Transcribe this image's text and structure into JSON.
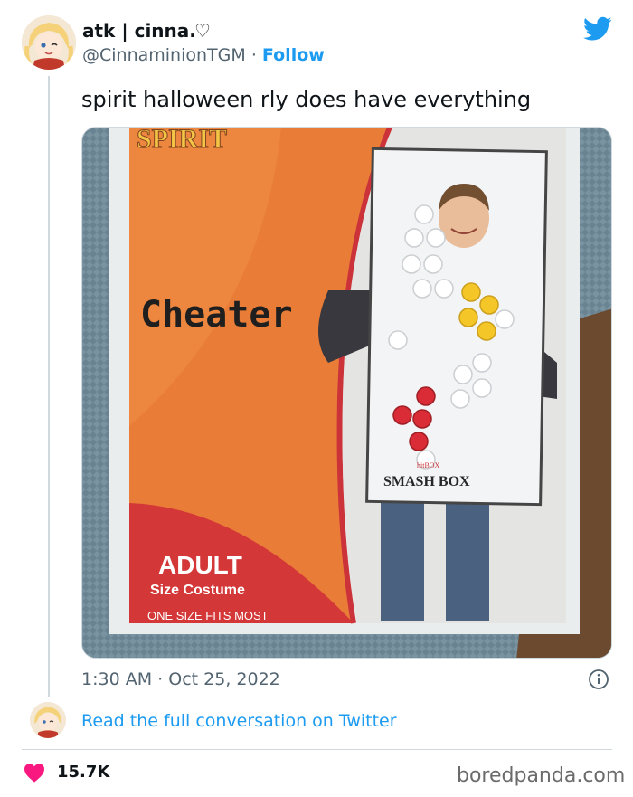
{
  "tweet": {
    "display_name": "atk | cinna.",
    "name_symbol": "♡",
    "handle": "@CinnaminionTGM",
    "separator": "·",
    "follow_label": "Follow",
    "text": "spirit halloween rly does have everything",
    "time": "1:30 AM",
    "date_separator": "·",
    "date": "Oct 25, 2022",
    "read_link": "Read the full conversation on Twitter",
    "likes": "15.7K"
  },
  "image": {
    "brand_text": "SPIRIT",
    "costume_title": "Cheater",
    "size_big": "ADULT",
    "size_small": "Size Costume",
    "fit_text": "ONE SIZE FITS MOST",
    "product_logo": "SMASH BOX",
    "product_small": "hitBOX"
  },
  "icons": {
    "bird": "twitter-bird-icon",
    "info": "info-icon",
    "like": "heart-icon"
  },
  "colors": {
    "accent": "#1d9bf0",
    "like": "#f91880",
    "text": "#0f1419",
    "muted": "#536471"
  },
  "watermark": "boredpanda.com"
}
